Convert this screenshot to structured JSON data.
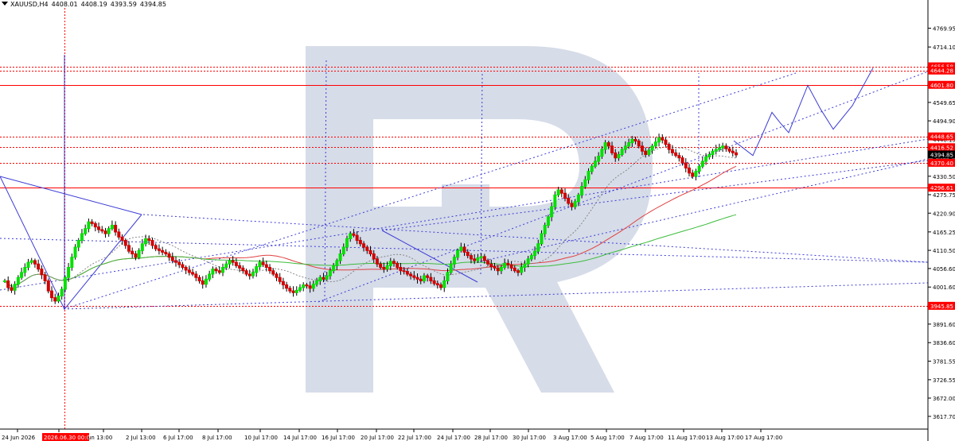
{
  "header": {
    "symbol": "XAUUSD,H4",
    "open": "4408.01",
    "high": "4408.19",
    "low": "4393.59",
    "close": "4394.85"
  },
  "chart_data": {
    "type": "candlestick",
    "symbol": "XAUUSD",
    "timeframe": "H4",
    "ylim": [
      3580,
      4830
    ],
    "y_ticks": [
      "4769.95",
      "4714.10",
      "4659.35",
      "4604.60",
      "4549.65",
      "4494.90",
      "4440.15",
      "4385.40",
      "4330.50",
      "4275.75",
      "4220.90",
      "4165.25",
      "4110.50",
      "4056.60",
      "4001.60",
      "3946.85",
      "3891.60",
      "3836.60",
      "3781.55",
      "3726.55",
      "3672.00",
      "3617.70"
    ],
    "x_labels": [
      "24 Jun 2026",
      "2026.06.30 00:00",
      "un 13:00",
      "2 Jul 13:00",
      "6 Jul 17:00",
      "8 Jul 17:00",
      "10 Jul 17:00",
      "14 Jul 17:00",
      "16 Jul 17:00",
      "20 Jul 17:00",
      "22 Jul 17:00",
      "24 Jul 17:00",
      "28 Jul 17:00",
      "30 Jul 17:00",
      "3 Aug 17:00",
      "5 Aug 17:00",
      "7 Aug 17:00",
      "11 Aug 17:00",
      "13 Aug 17:00",
      "17 Aug 17:00"
    ],
    "current_price": "4394.85",
    "level_labels": [
      {
        "value": 4656.58,
        "label": "4656.58",
        "style": "dotted"
      },
      {
        "value": 4644.28,
        "label": "4644.28",
        "style": "dotted"
      },
      {
        "value": 4601.8,
        "label": "4601.80",
        "style": "solid"
      },
      {
        "value": 4448.65,
        "label": "4448.65",
        "style": "dotted"
      },
      {
        "value": 4416.52,
        "label": "4416.52",
        "style": "dotted"
      },
      {
        "value": 4370.4,
        "label": "4370.40",
        "style": "dotted"
      },
      {
        "value": 4296.61,
        "label": "4296.61",
        "style": "solid"
      },
      {
        "value": 3945.85,
        "label": "3945.85",
        "style": "dotted"
      }
    ],
    "colors": {
      "bull": "#00e000",
      "bear": "#d00000",
      "level": "#ff0000",
      "trend": "#3d3dd6",
      "ma_slow": "#e04040",
      "ma_fast": "#3cbc3c",
      "watermark": "#d6dce8"
    },
    "zigzag": [
      [
        0,
        4120
      ],
      [
        14,
        3955
      ],
      [
        35,
        4195
      ],
      [
        84,
        4160
      ],
      [
        112,
        4005
      ],
      [
        154,
        4330
      ],
      [
        166,
        4270
      ],
      [
        185,
        4445
      ],
      [
        203,
        4320
      ],
      [
        222,
        4450
      ],
      [
        232,
        4510
      ],
      [
        245,
        4470
      ],
      [
        259,
        4605
      ],
      [
        272,
        4450
      ],
      [
        288,
        4660
      ]
    ],
    "closes": [
      4020,
      4000,
      3992,
      4010,
      4030,
      4045,
      4060,
      4075,
      4080,
      4070,
      4055,
      4038,
      4020,
      3990,
      3970,
      3960,
      3975,
      3995,
      4030,
      4060,
      4090,
      4120,
      4140,
      4160,
      4175,
      4195,
      4190,
      4180,
      4172,
      4168,
      4160,
      4175,
      4185,
      4165,
      4150,
      4140,
      4125,
      4108,
      4100,
      4090,
      4110,
      4130,
      4145,
      4140,
      4125,
      4115,
      4110,
      4105,
      4100,
      4090,
      4080,
      4075,
      4068,
      4060,
      4052,
      4045,
      4040,
      4030,
      4020,
      4010,
      4025,
      4040,
      4055,
      4050,
      4045,
      4060,
      4070,
      4080,
      4075,
      4065,
      4058,
      4050,
      4040,
      4035,
      4045,
      4062,
      4075,
      4068,
      4060,
      4050,
      4040,
      4030,
      4018,
      4008,
      3998,
      3990,
      3985,
      3992,
      4000,
      4008,
      4005,
      3998,
      4010,
      4020,
      4030,
      4025,
      4035,
      4050,
      4065,
      4080,
      4100,
      4120,
      4145,
      4160,
      4155,
      4140,
      4130,
      4120,
      4110,
      4100,
      4085,
      4070,
      4060,
      4055,
      4065,
      4078,
      4072,
      4060,
      4050,
      4048,
      4040,
      4035,
      4030,
      4025,
      4020,
      4035,
      4030,
      4020,
      4012,
      4008,
      4000,
      4020,
      4045,
      4070,
      4090,
      4110,
      4120,
      4105,
      4095,
      4085,
      4080,
      4088,
      4092,
      4080,
      4070,
      4062,
      4058,
      4050,
      4060,
      4072,
      4068,
      4058,
      4050,
      4045,
      4060,
      4070,
      4085,
      4095,
      4108,
      4130,
      4160,
      4185,
      4210,
      4240,
      4275,
      4290,
      4280,
      4265,
      4250,
      4240,
      4255,
      4275,
      4300,
      4320,
      4345,
      4360,
      4375,
      4390,
      4410,
      4430,
      4420,
      4400,
      4385,
      4395,
      4410,
      4420,
      4430,
      4440,
      4435,
      4420,
      4405,
      4395,
      4408,
      4420,
      4432,
      4445,
      4438,
      4425,
      4410,
      4400,
      4392,
      4385,
      4370,
      4355,
      4340,
      4330,
      4345,
      4360,
      4375,
      4388,
      4395,
      4405,
      4410,
      4415,
      4420,
      4412,
      4405,
      4400,
      4394
    ]
  }
}
